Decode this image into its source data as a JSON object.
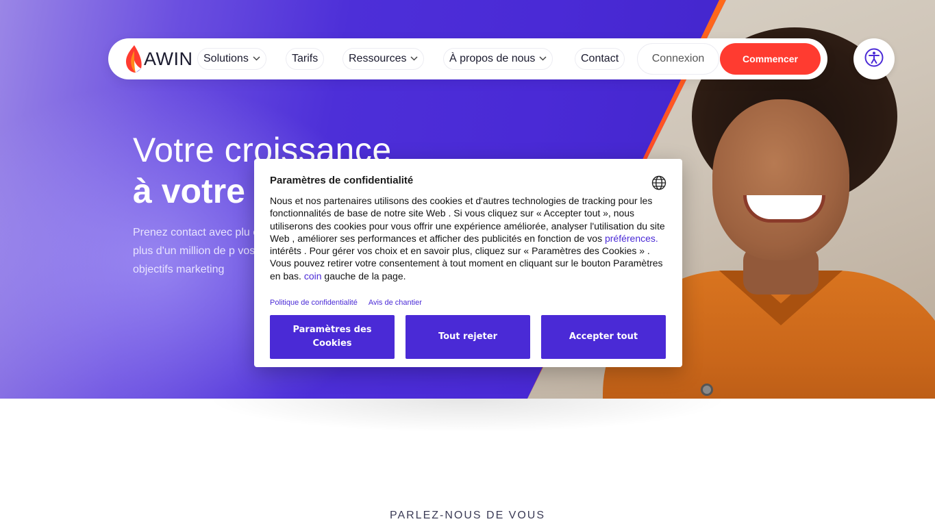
{
  "nav": {
    "logo_text": "AWIN",
    "items": [
      {
        "label": "Solutions",
        "has_dropdown": true
      },
      {
        "label": "Tarifs",
        "has_dropdown": false
      },
      {
        "label": "Ressources",
        "has_dropdown": true
      },
      {
        "label": "À propos de nous",
        "has_dropdown": true
      },
      {
        "label": "Contact",
        "has_dropdown": false
      }
    ],
    "login_label": "Connexion",
    "cta_label": "Commencer",
    "accessibility_icon": "accessibility-icon"
  },
  "hero": {
    "title_line1": "Votre croissance",
    "title_line2": "à votre f",
    "lead": "Prenez contact avec plu et plus d'un million de p vos objectifs marketing"
  },
  "cookie_dialog": {
    "title": "Paramètres de confidentialité",
    "globe_icon": "globe-icon",
    "body_part1": "Nous et nos partenaires utilisons des cookies et d'autres technologies de tracking pour les fonctionnalités de base de notre site Web . Si vous cliquez sur « Accepter tout  », nous utiliserons des cookies pour vous offrir une expérience améliorée, analyser l'utilisation du site Web , améliorer ses performances et afficher des publicités en fonction de vos ",
    "body_link1": "préférences.",
    "body_part2": " intérêts . Pour gérer vos choix et en savoir plus, cliquez sur « Paramètres des Cookies » . Vous pouvez retirer votre consentement à tout moment en cliquant sur le bouton Paramètres en bas. ",
    "body_link2": "coin",
    "body_part3": " gauche de la page.",
    "link_privacy": "Politique de confidentialité",
    "link_site": "Avis de chantier",
    "btn_settings": "Paramètres des Cookies",
    "btn_reject": "Tout rejeter",
    "btn_accept": "Accepter tout"
  },
  "section": {
    "label": "PARLEZ-NOUS DE VOUS"
  },
  "colors": {
    "brand_purple": "#4a2ad6",
    "cta_red": "#ff3b30",
    "stripe_orange": "#ff6a1a"
  }
}
